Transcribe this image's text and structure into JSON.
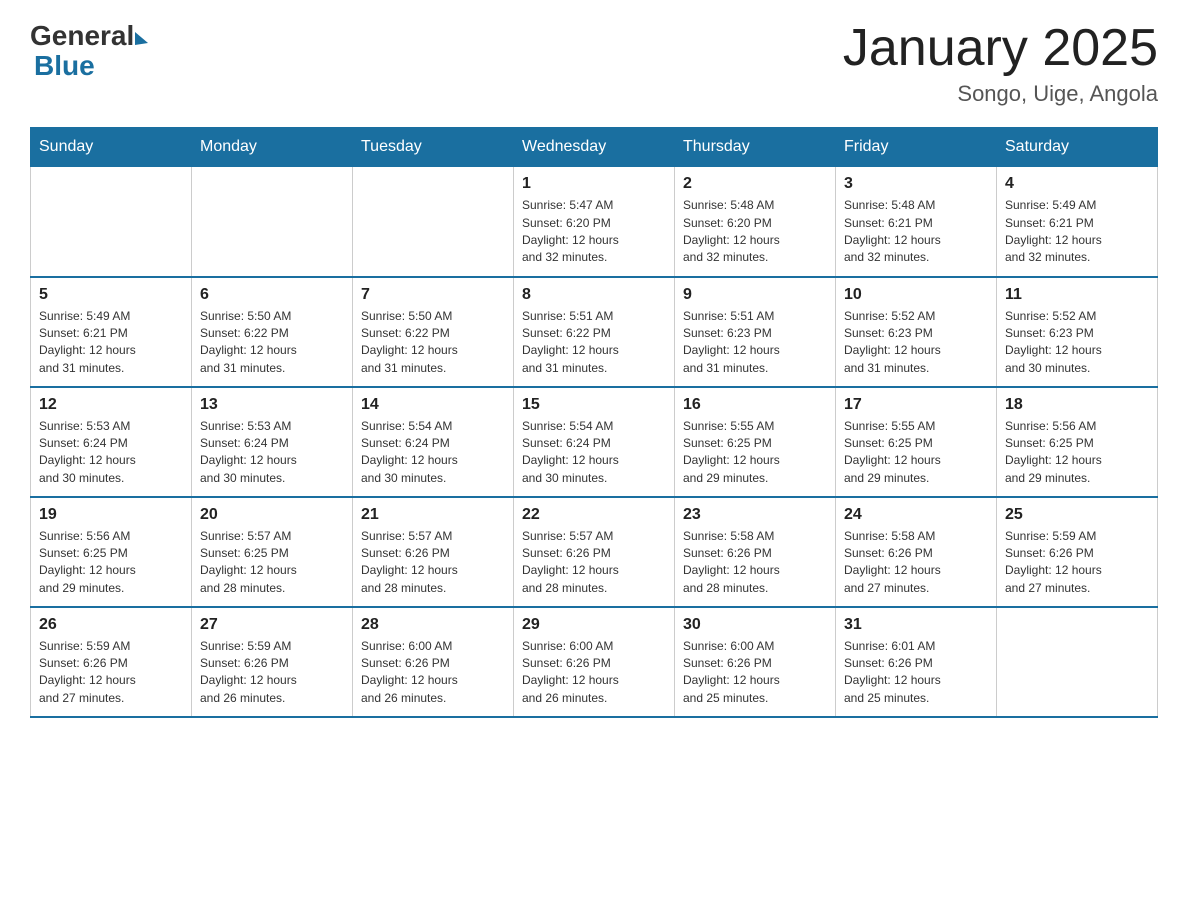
{
  "header": {
    "logo_general": "General",
    "logo_blue": "Blue",
    "title": "January 2025",
    "subtitle": "Songo, Uige, Angola"
  },
  "columns": [
    "Sunday",
    "Monday",
    "Tuesday",
    "Wednesday",
    "Thursday",
    "Friday",
    "Saturday"
  ],
  "weeks": [
    [
      {
        "day": "",
        "info": ""
      },
      {
        "day": "",
        "info": ""
      },
      {
        "day": "",
        "info": ""
      },
      {
        "day": "1",
        "info": "Sunrise: 5:47 AM\nSunset: 6:20 PM\nDaylight: 12 hours\nand 32 minutes."
      },
      {
        "day": "2",
        "info": "Sunrise: 5:48 AM\nSunset: 6:20 PM\nDaylight: 12 hours\nand 32 minutes."
      },
      {
        "day": "3",
        "info": "Sunrise: 5:48 AM\nSunset: 6:21 PM\nDaylight: 12 hours\nand 32 minutes."
      },
      {
        "day": "4",
        "info": "Sunrise: 5:49 AM\nSunset: 6:21 PM\nDaylight: 12 hours\nand 32 minutes."
      }
    ],
    [
      {
        "day": "5",
        "info": "Sunrise: 5:49 AM\nSunset: 6:21 PM\nDaylight: 12 hours\nand 31 minutes."
      },
      {
        "day": "6",
        "info": "Sunrise: 5:50 AM\nSunset: 6:22 PM\nDaylight: 12 hours\nand 31 minutes."
      },
      {
        "day": "7",
        "info": "Sunrise: 5:50 AM\nSunset: 6:22 PM\nDaylight: 12 hours\nand 31 minutes."
      },
      {
        "day": "8",
        "info": "Sunrise: 5:51 AM\nSunset: 6:22 PM\nDaylight: 12 hours\nand 31 minutes."
      },
      {
        "day": "9",
        "info": "Sunrise: 5:51 AM\nSunset: 6:23 PM\nDaylight: 12 hours\nand 31 minutes."
      },
      {
        "day": "10",
        "info": "Sunrise: 5:52 AM\nSunset: 6:23 PM\nDaylight: 12 hours\nand 31 minutes."
      },
      {
        "day": "11",
        "info": "Sunrise: 5:52 AM\nSunset: 6:23 PM\nDaylight: 12 hours\nand 30 minutes."
      }
    ],
    [
      {
        "day": "12",
        "info": "Sunrise: 5:53 AM\nSunset: 6:24 PM\nDaylight: 12 hours\nand 30 minutes."
      },
      {
        "day": "13",
        "info": "Sunrise: 5:53 AM\nSunset: 6:24 PM\nDaylight: 12 hours\nand 30 minutes."
      },
      {
        "day": "14",
        "info": "Sunrise: 5:54 AM\nSunset: 6:24 PM\nDaylight: 12 hours\nand 30 minutes."
      },
      {
        "day": "15",
        "info": "Sunrise: 5:54 AM\nSunset: 6:24 PM\nDaylight: 12 hours\nand 30 minutes."
      },
      {
        "day": "16",
        "info": "Sunrise: 5:55 AM\nSunset: 6:25 PM\nDaylight: 12 hours\nand 29 minutes."
      },
      {
        "day": "17",
        "info": "Sunrise: 5:55 AM\nSunset: 6:25 PM\nDaylight: 12 hours\nand 29 minutes."
      },
      {
        "day": "18",
        "info": "Sunrise: 5:56 AM\nSunset: 6:25 PM\nDaylight: 12 hours\nand 29 minutes."
      }
    ],
    [
      {
        "day": "19",
        "info": "Sunrise: 5:56 AM\nSunset: 6:25 PM\nDaylight: 12 hours\nand 29 minutes."
      },
      {
        "day": "20",
        "info": "Sunrise: 5:57 AM\nSunset: 6:25 PM\nDaylight: 12 hours\nand 28 minutes."
      },
      {
        "day": "21",
        "info": "Sunrise: 5:57 AM\nSunset: 6:26 PM\nDaylight: 12 hours\nand 28 minutes."
      },
      {
        "day": "22",
        "info": "Sunrise: 5:57 AM\nSunset: 6:26 PM\nDaylight: 12 hours\nand 28 minutes."
      },
      {
        "day": "23",
        "info": "Sunrise: 5:58 AM\nSunset: 6:26 PM\nDaylight: 12 hours\nand 28 minutes."
      },
      {
        "day": "24",
        "info": "Sunrise: 5:58 AM\nSunset: 6:26 PM\nDaylight: 12 hours\nand 27 minutes."
      },
      {
        "day": "25",
        "info": "Sunrise: 5:59 AM\nSunset: 6:26 PM\nDaylight: 12 hours\nand 27 minutes."
      }
    ],
    [
      {
        "day": "26",
        "info": "Sunrise: 5:59 AM\nSunset: 6:26 PM\nDaylight: 12 hours\nand 27 minutes."
      },
      {
        "day": "27",
        "info": "Sunrise: 5:59 AM\nSunset: 6:26 PM\nDaylight: 12 hours\nand 26 minutes."
      },
      {
        "day": "28",
        "info": "Sunrise: 6:00 AM\nSunset: 6:26 PM\nDaylight: 12 hours\nand 26 minutes."
      },
      {
        "day": "29",
        "info": "Sunrise: 6:00 AM\nSunset: 6:26 PM\nDaylight: 12 hours\nand 26 minutes."
      },
      {
        "day": "30",
        "info": "Sunrise: 6:00 AM\nSunset: 6:26 PM\nDaylight: 12 hours\nand 25 minutes."
      },
      {
        "day": "31",
        "info": "Sunrise: 6:01 AM\nSunset: 6:26 PM\nDaylight: 12 hours\nand 25 minutes."
      },
      {
        "day": "",
        "info": ""
      }
    ]
  ]
}
